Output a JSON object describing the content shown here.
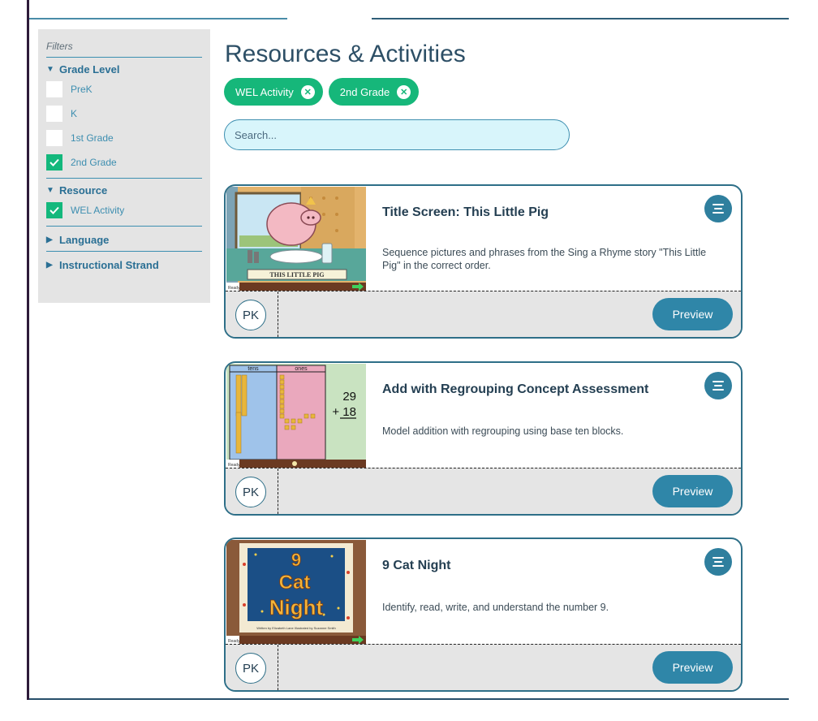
{
  "sidebar": {
    "title": "Filters",
    "grade_level": {
      "label": "Grade Level",
      "options": [
        {
          "label": "PreK",
          "checked": false
        },
        {
          "label": "K",
          "checked": false
        },
        {
          "label": "1st Grade",
          "checked": false
        },
        {
          "label": "2nd Grade",
          "checked": true
        }
      ]
    },
    "resource": {
      "label": "Resource",
      "options": [
        {
          "label": "WEL Activity",
          "checked": true
        }
      ]
    },
    "language": {
      "label": "Language"
    },
    "instructional_strand": {
      "label": "Instructional Strand"
    },
    "expanded_icon": "triangle-down-icon",
    "collapsed_icon": "triangle-right-icon"
  },
  "main": {
    "title": "Resources & Activities",
    "chips": [
      {
        "label": "WEL Activity",
        "remove_icon": "close-icon"
      },
      {
        "label": "2nd Grade",
        "remove_icon": "close-icon"
      }
    ],
    "search": {
      "placeholder": "Search...",
      "value": ""
    }
  },
  "cards": [
    {
      "title": "Title Screen: This Little Pig",
      "description": "Sequence pictures and phrases from the Sing a Rhyme story \"This Little Pig\" in the correct order.",
      "thumbnail_caption": "THIS LITTLE PIG",
      "thumbnail_footer": "Ready",
      "badge": "PK",
      "preview_label": "Preview"
    },
    {
      "title": "Add with Regrouping Concept Assessment",
      "description": "Model addition with regrouping using base ten blocks.",
      "thumbnail_headers": {
        "tens": "tens",
        "ones": "ones"
      },
      "thumbnail_problem": {
        "top": "29",
        "bottom": "+ 18"
      },
      "thumbnail_footer": "Ready",
      "badge": "PK",
      "preview_label": "Preview"
    },
    {
      "title": "9 Cat Night",
      "description": "Identify, read, write, and understand the number 9.",
      "thumbnail_title_lines": [
        "9",
        "Cat",
        "Night"
      ],
      "thumbnail_byline": "Written by Elizabeth Lane     Illustrated by Suzanne Smith",
      "thumbnail_footer": "Ready",
      "badge": "PK",
      "preview_label": "Preview"
    }
  ],
  "colors": {
    "accent_green": "#16b77a",
    "accent_blue": "#2f86a8",
    "heading": "#2d4f66",
    "link": "#3d8eb0",
    "search_bg": "#d8f5fb"
  }
}
